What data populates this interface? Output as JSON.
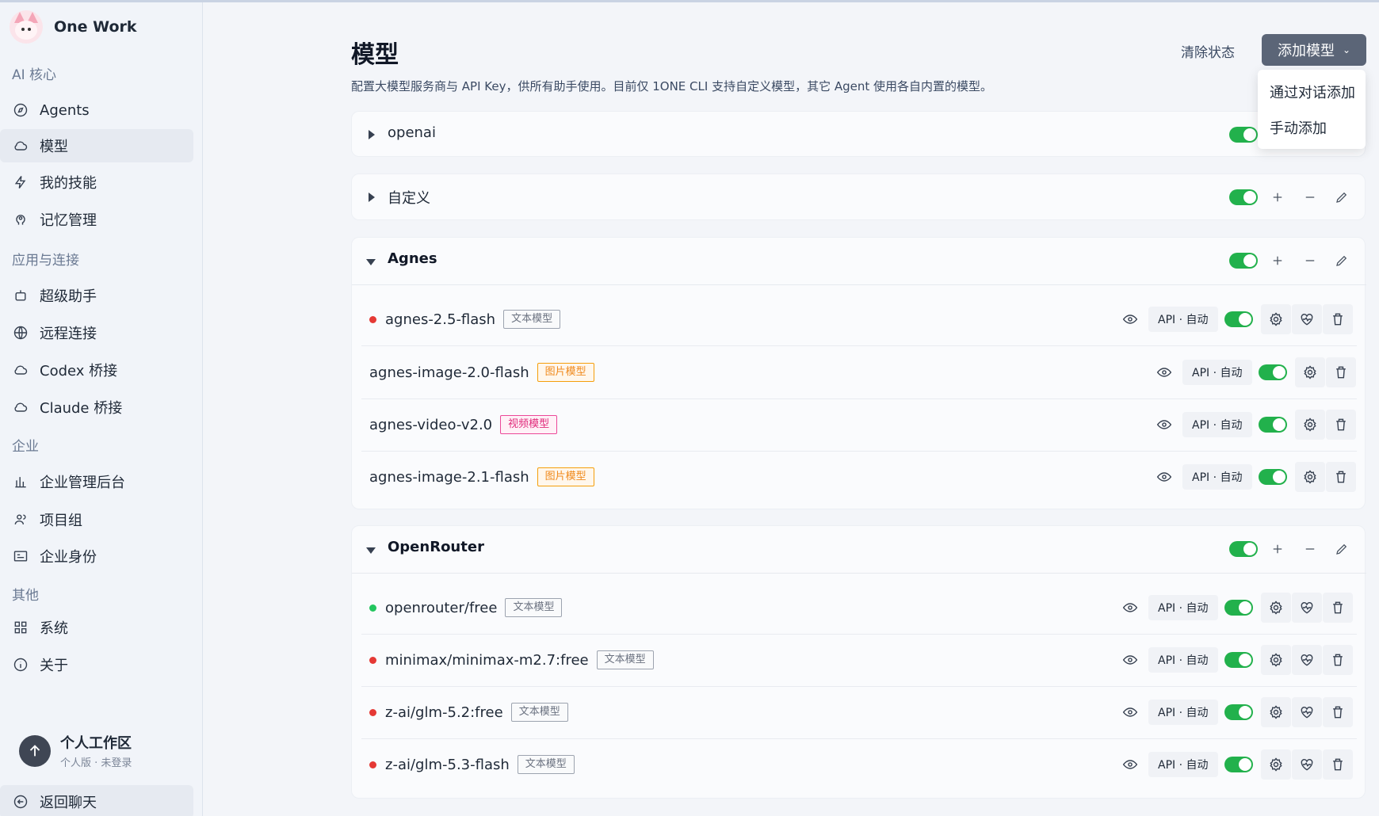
{
  "app": {
    "title": "One Work"
  },
  "sidebar": {
    "sections": [
      {
        "label": "AI 核心",
        "items": [
          {
            "label": "Agents",
            "icon": "compass-icon"
          },
          {
            "label": "模型",
            "icon": "cloud-icon",
            "active": true
          },
          {
            "label": "我的技能",
            "icon": "bolt-icon"
          },
          {
            "label": "记忆管理",
            "icon": "brain-icon"
          }
        ]
      },
      {
        "label": "应用与连接",
        "items": [
          {
            "label": "超级助手",
            "icon": "robot-icon"
          },
          {
            "label": "远程连接",
            "icon": "globe-icon"
          },
          {
            "label": "Codex 桥接",
            "icon": "cloud-icon"
          },
          {
            "label": "Claude 桥接",
            "icon": "cloud-icon"
          }
        ]
      },
      {
        "label": "企业",
        "items": [
          {
            "label": "企业管理后台",
            "icon": "building-icon"
          },
          {
            "label": "项目组",
            "icon": "users-icon"
          },
          {
            "label": "企业身份",
            "icon": "id-card-icon"
          }
        ]
      },
      {
        "label": "其他",
        "items": [
          {
            "label": "系统",
            "icon": "grid-icon"
          },
          {
            "label": "关于",
            "icon": "info-icon"
          }
        ]
      }
    ],
    "user": {
      "name": "个人工作区",
      "sub": "个人版 · 未登录"
    },
    "back": {
      "label": "返回聊天"
    }
  },
  "header": {
    "title": "模型",
    "description": "配置大模型服务商与 API Key，供所有助手使用。目前仅 1ONE CLI 支持自定义模型，其它 Agent 使用各自内置的模型。",
    "clear_label": "清除状态",
    "add_label": "添加模型",
    "dropdown": [
      "通过对话添加",
      "手动添加"
    ]
  },
  "providers": [
    {
      "name": "openai",
      "expanded": false,
      "enabled": true
    },
    {
      "name": "自定义",
      "expanded": false,
      "enabled": true
    },
    {
      "name": "Agnes",
      "expanded": true,
      "enabled": true,
      "models": [
        {
          "name": "agnes-2.5-flash",
          "tag": "文本模型",
          "tag_type": "text",
          "status": "red",
          "api": "API · 自动",
          "enabled": true,
          "has_health": true
        },
        {
          "name": "agnes-image-2.0-flash",
          "tag": "图片模型",
          "tag_type": "image",
          "status": null,
          "api": "API · 自动",
          "enabled": true,
          "has_health": false
        },
        {
          "name": "agnes-video-v2.0",
          "tag": "视频模型",
          "tag_type": "video",
          "status": null,
          "api": "API · 自动",
          "enabled": true,
          "has_health": false
        },
        {
          "name": "agnes-image-2.1-flash",
          "tag": "图片模型",
          "tag_type": "image",
          "status": null,
          "api": "API · 自动",
          "enabled": true,
          "has_health": false
        }
      ]
    },
    {
      "name": "OpenRouter",
      "expanded": true,
      "enabled": true,
      "models": [
        {
          "name": "openrouter/free",
          "tag": "文本模型",
          "tag_type": "text",
          "status": "green",
          "api": "API · 自动",
          "enabled": true,
          "has_health": true
        },
        {
          "name": "minimax/minimax-m2.7:free",
          "tag": "文本模型",
          "tag_type": "text",
          "status": "red",
          "api": "API · 自动",
          "enabled": true,
          "has_health": true
        },
        {
          "name": "z-ai/glm-5.2:free",
          "tag": "文本模型",
          "tag_type": "text",
          "status": "red",
          "api": "API · 自动",
          "enabled": true,
          "has_health": true
        },
        {
          "name": "z-ai/glm-5.3-flash",
          "tag": "文本模型",
          "tag_type": "text",
          "status": "red",
          "api": "API · 自动",
          "enabled": true,
          "has_health": true
        }
      ]
    }
  ]
}
